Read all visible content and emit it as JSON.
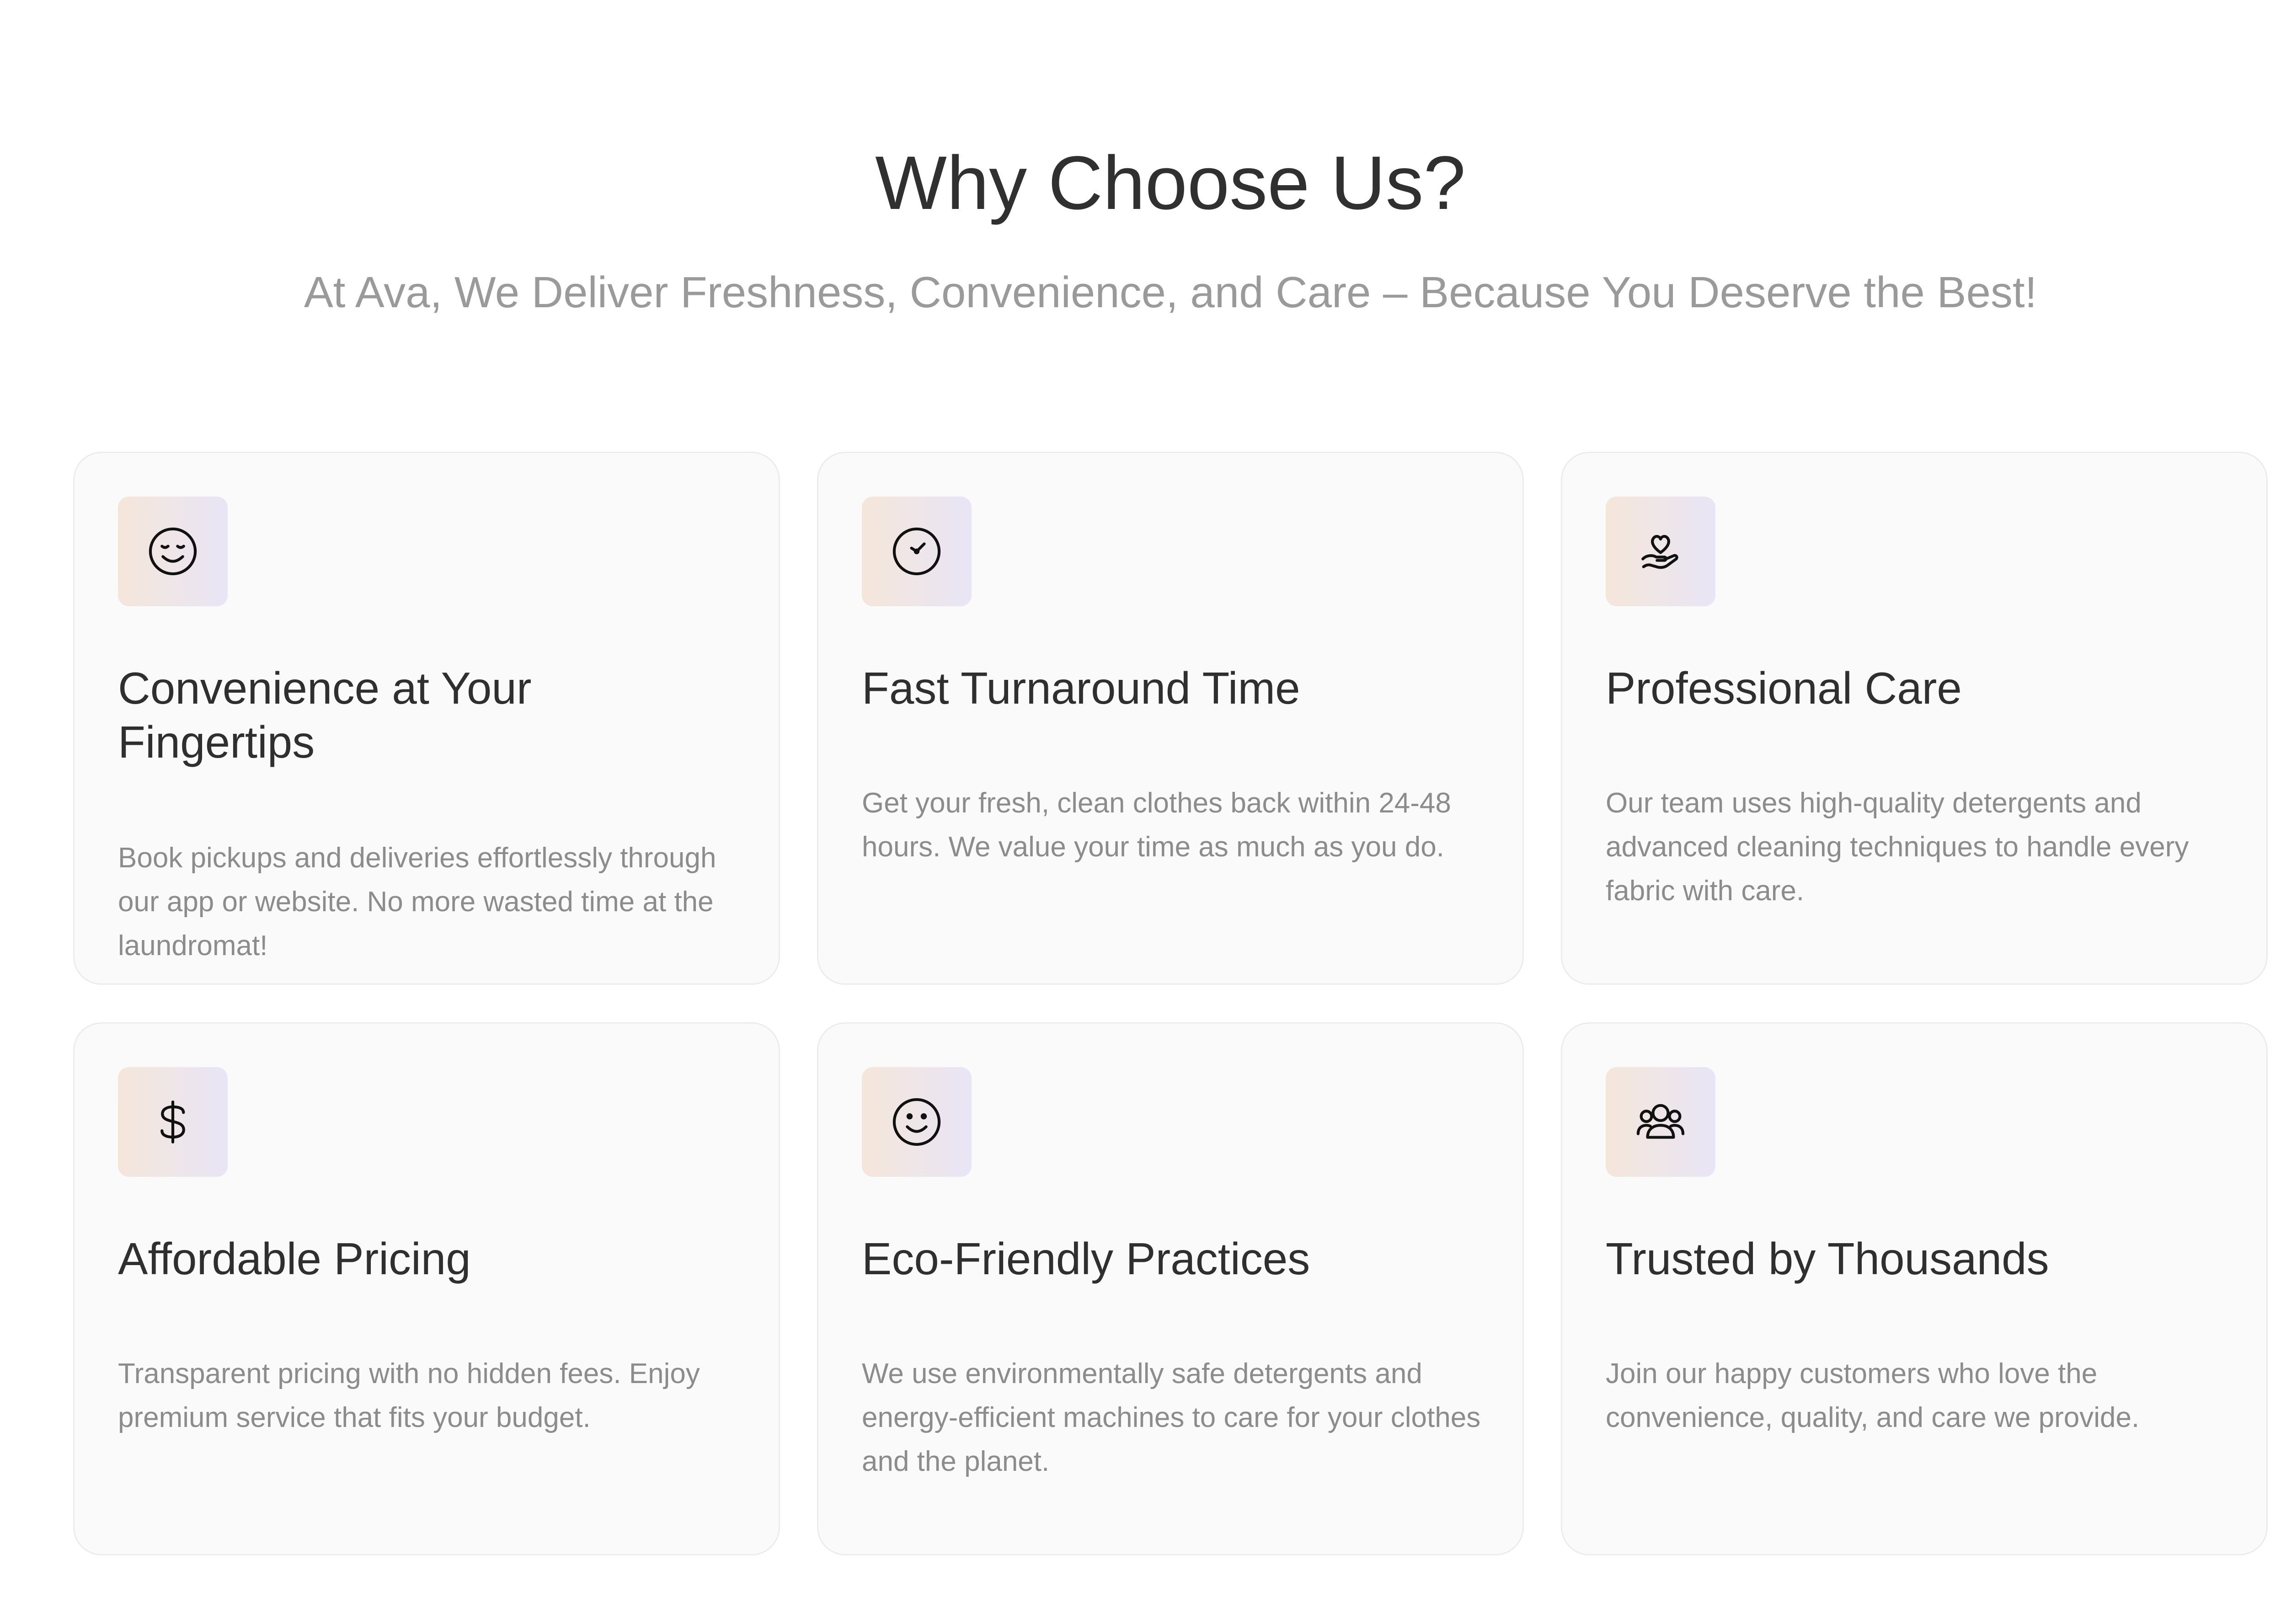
{
  "section": {
    "title": "Why Choose Us?",
    "subtitle": "At Ava, We Deliver Freshness, Convenience, and Care – Because You Deserve the Best!"
  },
  "features": [
    {
      "icon": "happy-face-icon",
      "title": "Convenience at Your Fingertips",
      "description": "Book pickups and deliveries effortlessly through our app or website. No more wasted time at the laundromat!"
    },
    {
      "icon": "clock-icon",
      "title": "Fast Turnaround Time",
      "description": "Get your fresh, clean clothes back within 24-48 hours. We value your time as much as you do."
    },
    {
      "icon": "hand-heart-icon",
      "title": "Professional Care",
      "description": "Our team uses high-quality detergents and advanced cleaning techniques to handle every fabric with care."
    },
    {
      "icon": "dollar-sign-icon",
      "title": "Affordable Pricing",
      "description": "Transparent pricing with no hidden fees. Enjoy premium service that fits your budget."
    },
    {
      "icon": "smile-icon",
      "title": "Eco-Friendly Practices",
      "description": "We use environmentally safe detergents and energy-efficient machines to care for your clothes and the planet."
    },
    {
      "icon": "users-icon",
      "title": "Trusted by Thousands",
      "description": "Join our happy customers who love the convenience, quality, and care we provide."
    }
  ],
  "colors": {
    "card_background": "#fafafa",
    "card_border": "#ececec",
    "icon_gradient_start": "#f5e6da",
    "icon_gradient_end": "#e8e5f6",
    "title_text": "#2f2f2f",
    "muted_text": "#8c8c8c"
  }
}
